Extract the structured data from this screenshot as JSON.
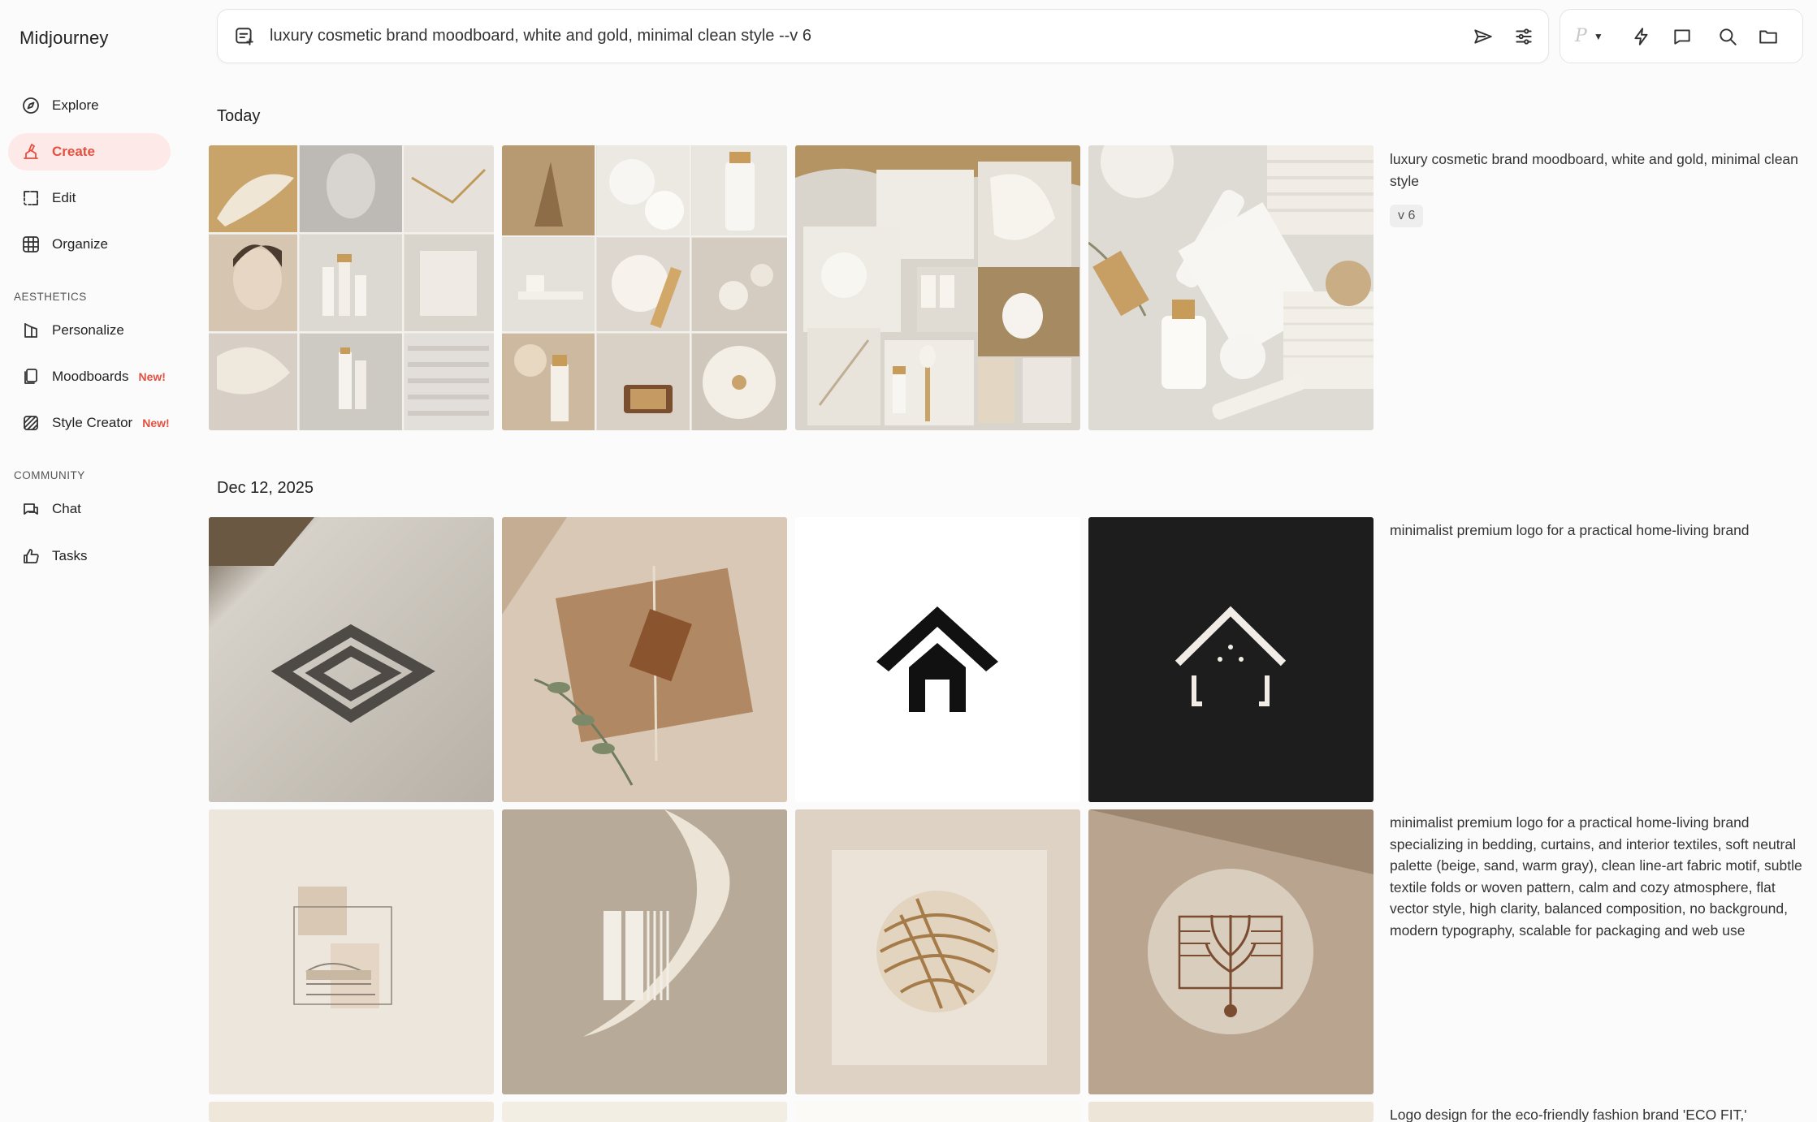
{
  "app": {
    "name": "Midjourney"
  },
  "sidebar": {
    "items": [
      {
        "label": "Explore"
      },
      {
        "label": "Create"
      },
      {
        "label": "Edit"
      },
      {
        "label": "Organize"
      }
    ],
    "aesthetics_label": "AESTHETICS",
    "aesthetics_items": [
      {
        "label": "Personalize",
        "badge": ""
      },
      {
        "label": "Moodboards",
        "badge": "New!"
      },
      {
        "label": "Style Creator",
        "badge": "New!"
      }
    ],
    "community_label": "COMMUNITY",
    "community_items": [
      {
        "label": "Chat"
      },
      {
        "label": "Tasks"
      }
    ]
  },
  "prompt_bar": {
    "value": "luxury cosmetic brand moodboard, white and gold, minimal clean style --v 6"
  },
  "toolbar": {
    "profile_letter": "P"
  },
  "groups": [
    {
      "date": "Today",
      "rows": [
        {
          "caption": "luxury cosmetic brand moodboard, white and gold, minimal clean style",
          "badge": "v 6"
        }
      ]
    },
    {
      "date": "Dec 12, 2025",
      "rows": [
        {
          "caption": "minimalist premium logo for a practical home-living brand"
        },
        {
          "caption": "minimalist premium logo for a practical home-living brand specializing in bedding, curtains, and interior textiles, soft neutral palette (beige, sand, warm gray), clean line-art fabric motif, subtle textile folds or woven pattern, calm and cozy atmosphere, flat vector style, high clarity, balanced composition, no background, modern typography, scalable for packaging and web use"
        },
        {
          "caption": "Logo design for the eco-friendly fashion brand 'ECO FIT,'"
        }
      ]
    }
  ],
  "icons": {
    "explore": "compass-icon",
    "create": "brush-icon",
    "edit": "edit-icon",
    "organize": "grid-icon",
    "personalize": "personalize-icon",
    "moodboards": "moodboard-icon",
    "style_creator": "style-icon",
    "chat": "chat-icon",
    "tasks": "thumbs-up-icon"
  },
  "colors": {
    "accent": "#e4503f",
    "active_bg": "#fde9e7",
    "background": "#fbfbfb"
  }
}
